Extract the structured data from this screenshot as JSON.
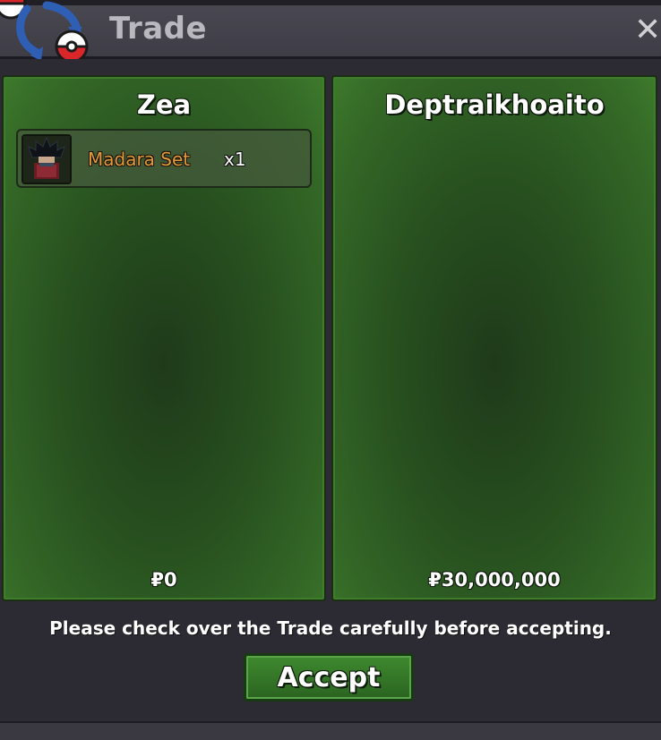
{
  "window": {
    "title": "Trade",
    "close_symbol": "✕"
  },
  "panels": [
    {
      "name": "Zea",
      "money": "₽0",
      "items": [
        {
          "name": "Madara Set",
          "quantity": "x1",
          "icon": "madara-character-icon"
        }
      ]
    },
    {
      "name": "Deptraikhoaito",
      "money": "₽30,000,000",
      "items": []
    }
  ],
  "footer": {
    "notice": "Please check over the Trade carefully before accepting.",
    "accept_label": "Accept"
  },
  "colors": {
    "panel_green": "#2f5d24",
    "item_name_orange": "#e09a3c",
    "accept_green": "#3f8a2f"
  }
}
